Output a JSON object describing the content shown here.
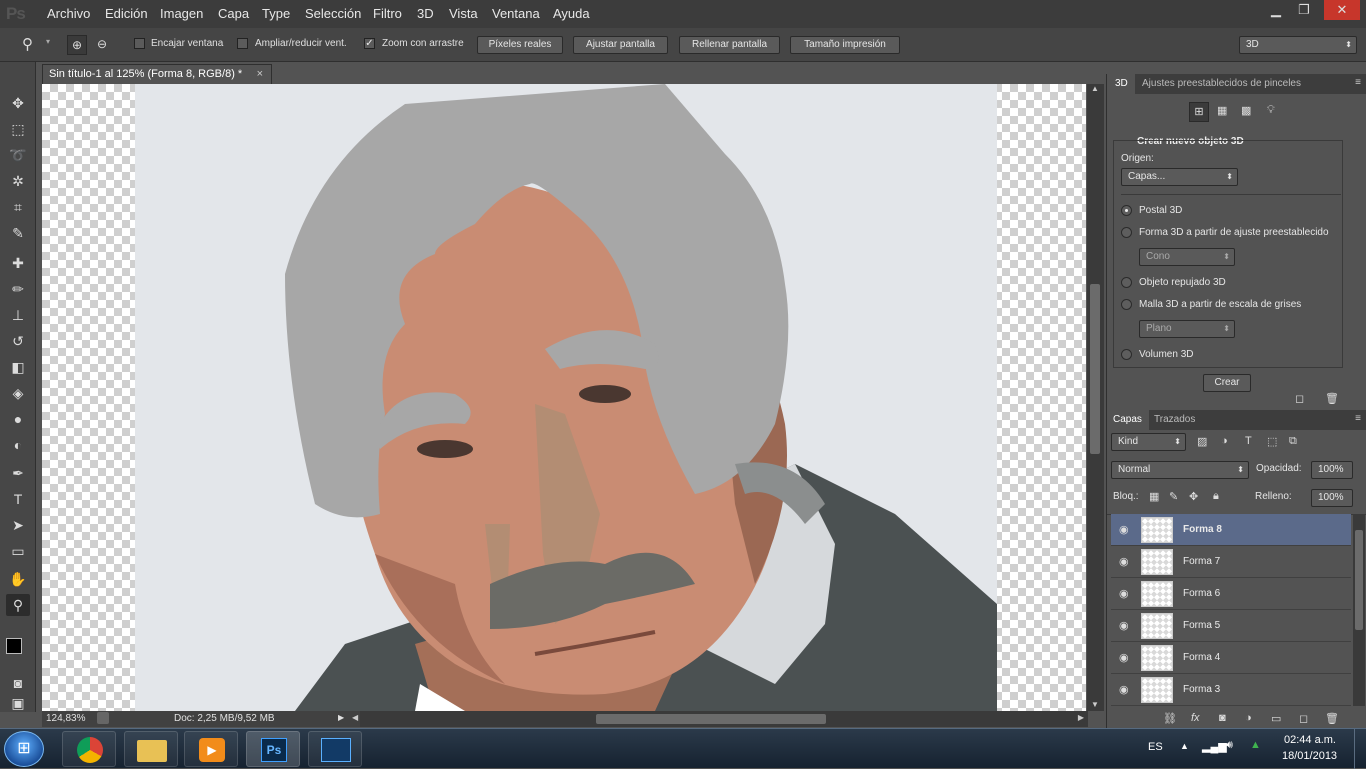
{
  "menu": [
    "Archivo",
    "Edición",
    "Imagen",
    "Capa",
    "Type",
    "Selección",
    "Filtro",
    "3D",
    "Vista",
    "Ventana",
    "Ayuda"
  ],
  "app_logo": "Ps",
  "window_controls": {
    "minimize": "▁",
    "restore": "❐",
    "close": "✕"
  },
  "options": {
    "encajar": "Encajar ventana",
    "ampliar": "Ampliar/reducir vent.",
    "zoom_arrastre": "Zoom con arrastre",
    "pixeles": "Píxeles reales",
    "ajustar": "Ajustar pantalla",
    "rellenar": "Rellenar pantalla",
    "tamano": "Tamaño impresión",
    "workspace": "3D"
  },
  "document": {
    "tab_title": "Sin título-1 al 125% (Forma 8, RGB/8) *",
    "close": "×"
  },
  "status": {
    "zoom": "124,83%",
    "doc": "Doc: 2,25 MB/9,52 MB"
  },
  "panel3d": {
    "tabs": [
      "3D",
      "Ajustes preestablecidos de pinceles"
    ],
    "header": "Crear nuevo objeto 3D",
    "origin_label": "Origen:",
    "origin_value": "Capas...",
    "options": [
      "Postal 3D",
      "Forma 3D a partir de ajuste preestablecido",
      "Objeto repujado 3D",
      "Malla 3D a partir de escala de grises",
      "Volumen 3D"
    ],
    "preset_shape": "Cono",
    "preset_plane": "Plano",
    "create_button": "Crear"
  },
  "layers_panel": {
    "tabs": [
      "Capas",
      "Trazados"
    ],
    "kind": "Kind",
    "blend_mode": "Normal",
    "opacity_label": "Opacidad:",
    "opacity_value": "100%",
    "lock_label": "Bloq.:",
    "fill_label": "Relleno:",
    "fill_value": "100%",
    "layers": [
      {
        "name": "Forma 8",
        "selected": true
      },
      {
        "name": "Forma 7",
        "selected": false
      },
      {
        "name": "Forma 6",
        "selected": false
      },
      {
        "name": "Forma 5",
        "selected": false
      },
      {
        "name": "Forma 4",
        "selected": false
      },
      {
        "name": "Forma 3",
        "selected": false
      }
    ]
  },
  "taskbar": {
    "lang": "ES",
    "time": "02:44 a.m.",
    "date": "18/01/2013",
    "ps_label": "Ps"
  },
  "colors": {
    "accent_selected": "#5b6a8a",
    "foreground": "#000000",
    "background": "#ff0000"
  }
}
